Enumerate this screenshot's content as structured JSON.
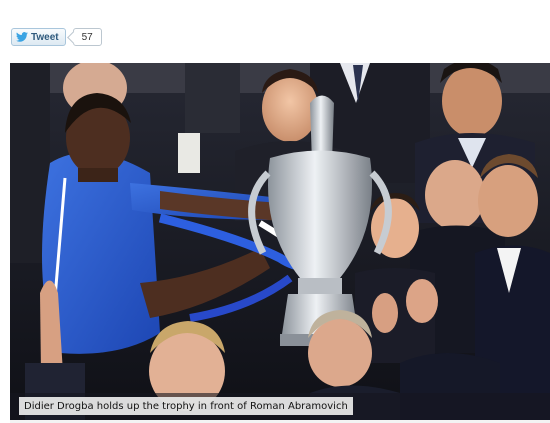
{
  "share": {
    "tweet_label": "Tweet",
    "tweet_count": "57",
    "icon": "twitter-bird-icon"
  },
  "photo": {
    "caption": "Didier Drogba holds up the trophy in front of Roman Abramovich"
  }
}
